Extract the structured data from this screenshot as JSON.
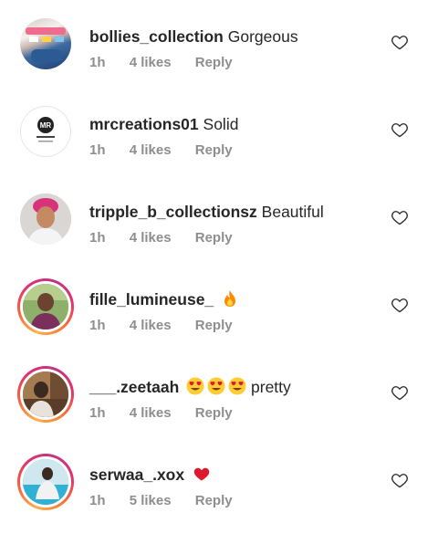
{
  "comments": [
    {
      "username": "bollies_collection",
      "text": "Gorgeous",
      "time": "1h",
      "likes": "4 likes",
      "reply": "Reply",
      "emoji": [],
      "avatar_icon": "shoes-photo-avatar"
    },
    {
      "username": "mrcreations01",
      "text": "Solid",
      "time": "1h",
      "likes": "4 likes",
      "reply": "Reply",
      "emoji": [],
      "avatar_icon": "mr-logo-avatar"
    },
    {
      "username": "tripple_b_collectionsz",
      "text": "Beautiful",
      "time": "1h",
      "likes": "4 likes",
      "reply": "Reply",
      "emoji": [],
      "avatar_icon": "person-photo-avatar"
    },
    {
      "username": "fille_lumineuse_",
      "text": "",
      "time": "1h",
      "likes": "4 likes",
      "reply": "Reply",
      "emoji": [
        "fire-emoji"
      ],
      "avatar_icon": "person-photo-avatar"
    },
    {
      "username": "___.zeetaah",
      "text": "pretty",
      "time": "1h",
      "likes": "4 likes",
      "reply": "Reply",
      "emoji": [
        "heart-eyes-emoji",
        "heart-eyes-emoji",
        "heart-eyes-emoji"
      ],
      "avatar_icon": "person-photo-avatar"
    },
    {
      "username": "serwaa_.xox",
      "text": "",
      "time": "1h",
      "likes": "5 likes",
      "reply": "Reply",
      "emoji": [
        "red-heart-emoji"
      ],
      "avatar_icon": "person-photo-avatar"
    }
  ],
  "colors": {
    "text": "#262626",
    "meta": "#8e8e8e",
    "heart_outline": "#262626",
    "red_heart": "#e0162b",
    "fire": "#ff8a00",
    "emoji_face": "#ffcc33"
  },
  "icons": {
    "like": "heart-outline-icon"
  },
  "mr_logo_text": "MR"
}
